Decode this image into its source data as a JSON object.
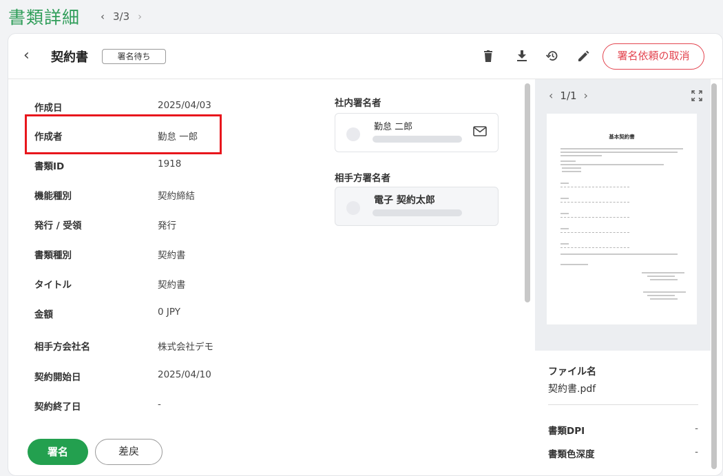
{
  "page": {
    "title": "書類詳細",
    "pager": {
      "current": "3/3"
    }
  },
  "header": {
    "doc_title": "契約書",
    "status_badge": "署名待ち",
    "cancel_label": "署名依頼の取消",
    "tool_icons": [
      "trash-icon",
      "download-icon",
      "history-icon",
      "edit-icon"
    ]
  },
  "details": [
    {
      "key": "作成日",
      "value": "2025/04/03"
    },
    {
      "key": "作成者",
      "value": "勤怠 一郎"
    },
    {
      "key": "書類ID",
      "value": "1918"
    },
    {
      "key": "機能種別",
      "value": "契約締結"
    },
    {
      "key": "発行 / 受領",
      "value": "発行"
    },
    {
      "key": "書類種別",
      "value": "契約書"
    },
    {
      "key": "タイトル",
      "value": "契約書"
    },
    {
      "key": "金額",
      "value": "0 JPY"
    },
    {
      "key": "相手方会社名",
      "value": "株式会社デモ"
    },
    {
      "key": "契約開始日",
      "value": "2025/04/10"
    },
    {
      "key": "契約終了日",
      "value": "-"
    }
  ],
  "signers": {
    "internal_label": "社内署名者",
    "internal_name": "勤怠 二郎",
    "counterparty_label": "相手方署名者",
    "counterparty_name": "電子 契約太郎"
  },
  "preview": {
    "pager": "1/1",
    "doc_heading": "基本契約書"
  },
  "file_info": {
    "filename_label": "ファイル名",
    "filename": "契約書.pdf",
    "dpi_label": "書類DPI",
    "dpi_value": "-",
    "depth_label": "書類色深度",
    "depth_value": "-"
  },
  "actions": {
    "sign_label": "署名",
    "return_label": "差戻"
  },
  "colors": {
    "brand_green": "#2f9d59",
    "sign_button": "#23a04f",
    "cancel_red": "#e3444f",
    "highlight_red": "#e8161c"
  }
}
